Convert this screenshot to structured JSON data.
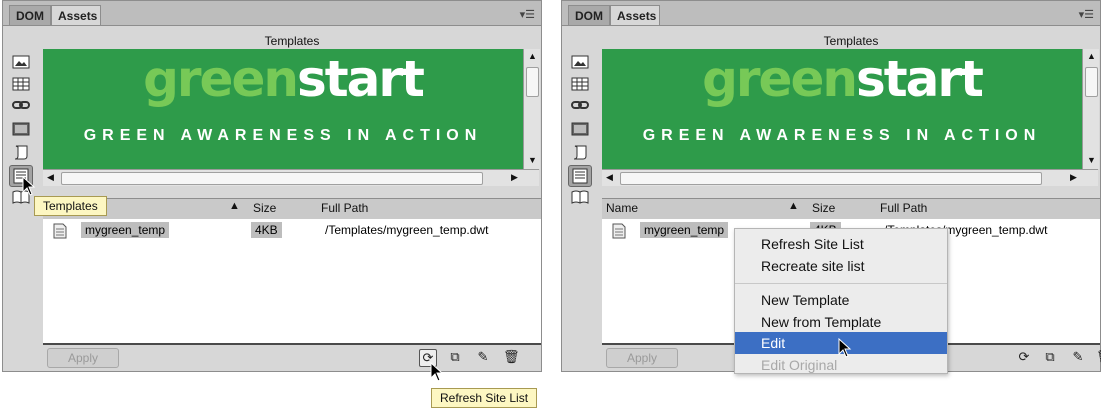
{
  "panels": [
    {
      "tabs": [
        {
          "label": "DOM"
        },
        {
          "label": "Assets"
        }
      ],
      "header": "Templates",
      "preview": {
        "logo_part1": "green",
        "logo_part2": "start",
        "tagline": "GREEN AWARENESS IN ACTION"
      },
      "columns": {
        "name": "",
        "size": "Size",
        "full_path": "Full Path"
      },
      "row": {
        "name": "mygreen_temp",
        "size": "4KB",
        "path": "/Templates/mygreen_temp.dwt"
      },
      "apply_label": "Apply"
    },
    {
      "tabs": [
        {
          "label": "DOM"
        },
        {
          "label": "Assets"
        }
      ],
      "header": "Templates",
      "preview": {
        "logo_part1": "green",
        "logo_part2": "start",
        "tagline": "GREEN AWARENESS IN ACTION"
      },
      "columns": {
        "name": "Name",
        "size": "Size",
        "full_path": "Full Path"
      },
      "row": {
        "name": "mygreen_temp",
        "size": "4KB",
        "path": "/Templates/mygreen_temp.dwt"
      },
      "apply_label": "Apply"
    }
  ],
  "tooltips": {
    "templates": "Templates",
    "refresh": "Refresh Site List"
  },
  "context_menu": {
    "items": [
      {
        "label": "Refresh Site List"
      },
      {
        "label": "Recreate site list"
      },
      {
        "label": "New Template"
      },
      {
        "label": "New from Template"
      },
      {
        "label": "Edit"
      },
      {
        "label": "Edit Original"
      }
    ]
  },
  "colors": {
    "brand_green": "#2e9b4a",
    "logo_light_green": "#77c957",
    "menu_highlight": "#3c6fc4",
    "tooltip_bg": "#fdf7c2"
  },
  "icons": [
    "image-icon",
    "grid-icon",
    "link-icon",
    "film-icon",
    "script-icon",
    "templates-icon",
    "library-icon",
    "refresh-icon",
    "new-template-icon",
    "edit-icon",
    "trash-icon",
    "panel-menu-icon"
  ]
}
